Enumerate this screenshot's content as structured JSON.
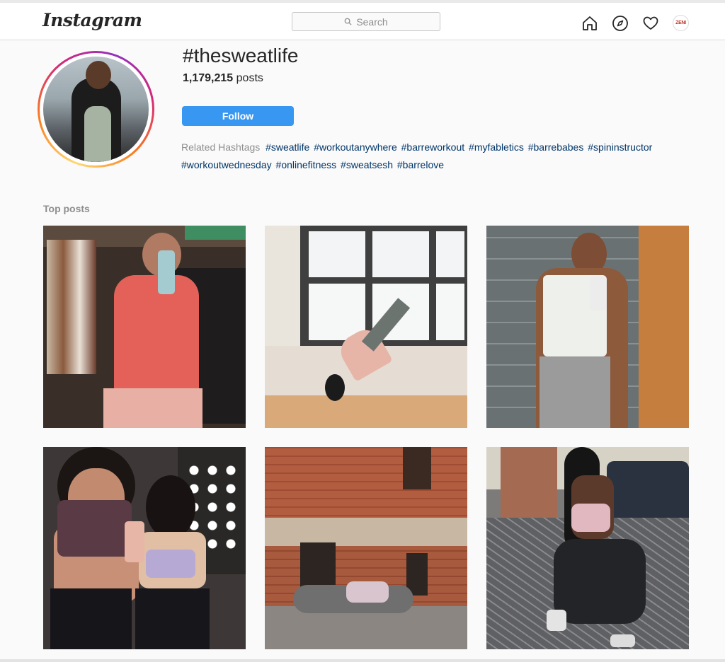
{
  "nav": {
    "logo": "Instagram",
    "search_placeholder": "Search",
    "avatar_text": "ZENI"
  },
  "hashtag": {
    "title": "#thesweatlife",
    "posts_count": "1,179,215",
    "posts_label": "posts",
    "follow_label": "Follow",
    "related_label": "Related Hashtags",
    "related": [
      "#sweatlife",
      "#workoutanywhere",
      "#barreworkout",
      "#myfabletics",
      "#barrebabes",
      "#spininstructor",
      "#workoutwednesday",
      "#onlinefitness",
      "#sweatsesh",
      "#barrelove"
    ]
  },
  "top_posts": {
    "label": "Top posts",
    "tiles": [
      {
        "bg": "#3a2f28"
      },
      {
        "bg": "#e9e4dc"
      },
      {
        "bg": "#6f7577"
      },
      {
        "bg": "#3d3837"
      },
      {
        "bg": "#a4553b"
      },
      {
        "bg": "#7d7b7a"
      }
    ]
  },
  "colors": {
    "accent": "#3897f0",
    "link": "#003569"
  }
}
